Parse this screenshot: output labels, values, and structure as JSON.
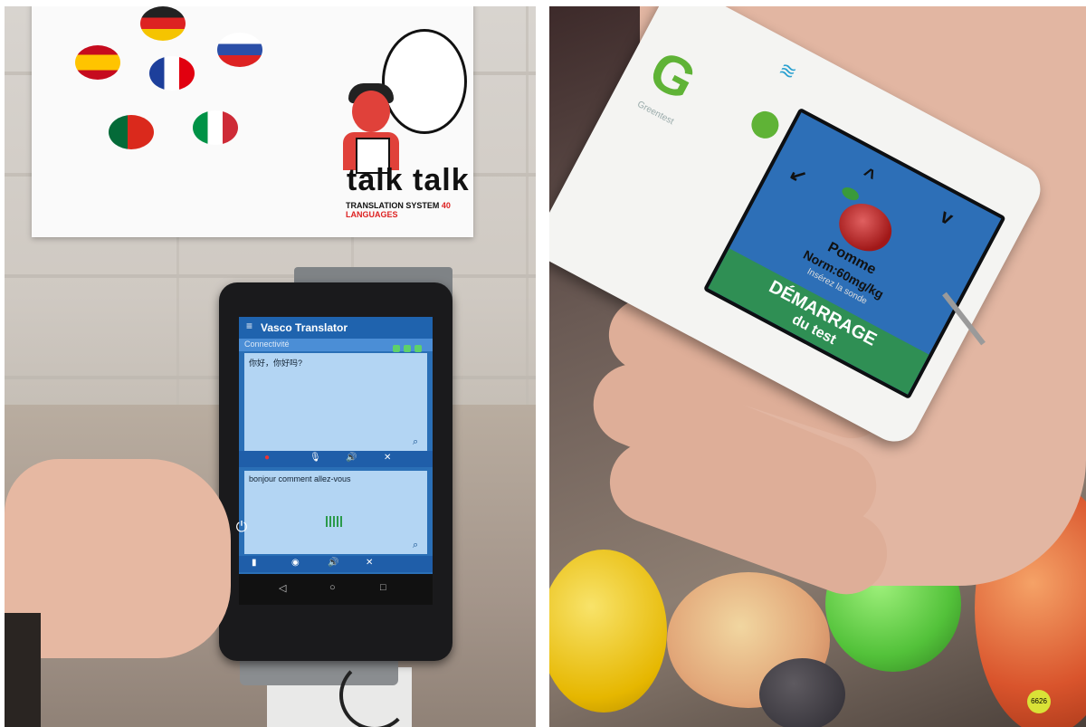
{
  "left_photo": {
    "poster": {
      "brand": "talk talk",
      "tagline_prefix": "TRANSLATION SYSTEM ",
      "tagline_highlight": "40 LANGUAGES"
    },
    "translator_app": {
      "title": "Vasco Translator",
      "menu_icon": "hamburger-icon",
      "subbar_label": "Connectivité",
      "source_text": "你好，你好吗?",
      "target_text": "bonjour comment allez-vous",
      "toolbar_icons": [
        "record-icon",
        "mic-icon",
        "speaker-icon",
        "close-icon"
      ],
      "nav_icons": [
        "back-icon",
        "home-icon",
        "recents-icon"
      ]
    }
  },
  "right_photo": {
    "device": {
      "brand_logo": "G",
      "model_label": "Greentest",
      "screen": {
        "item_name": "Pomme",
        "norm": "Norm:60mg/kg",
        "hint": "Insérez la sonde",
        "button_line1": "DÉMARRAGE",
        "button_line2": "du test"
      }
    },
    "sticker_text": "6626"
  }
}
